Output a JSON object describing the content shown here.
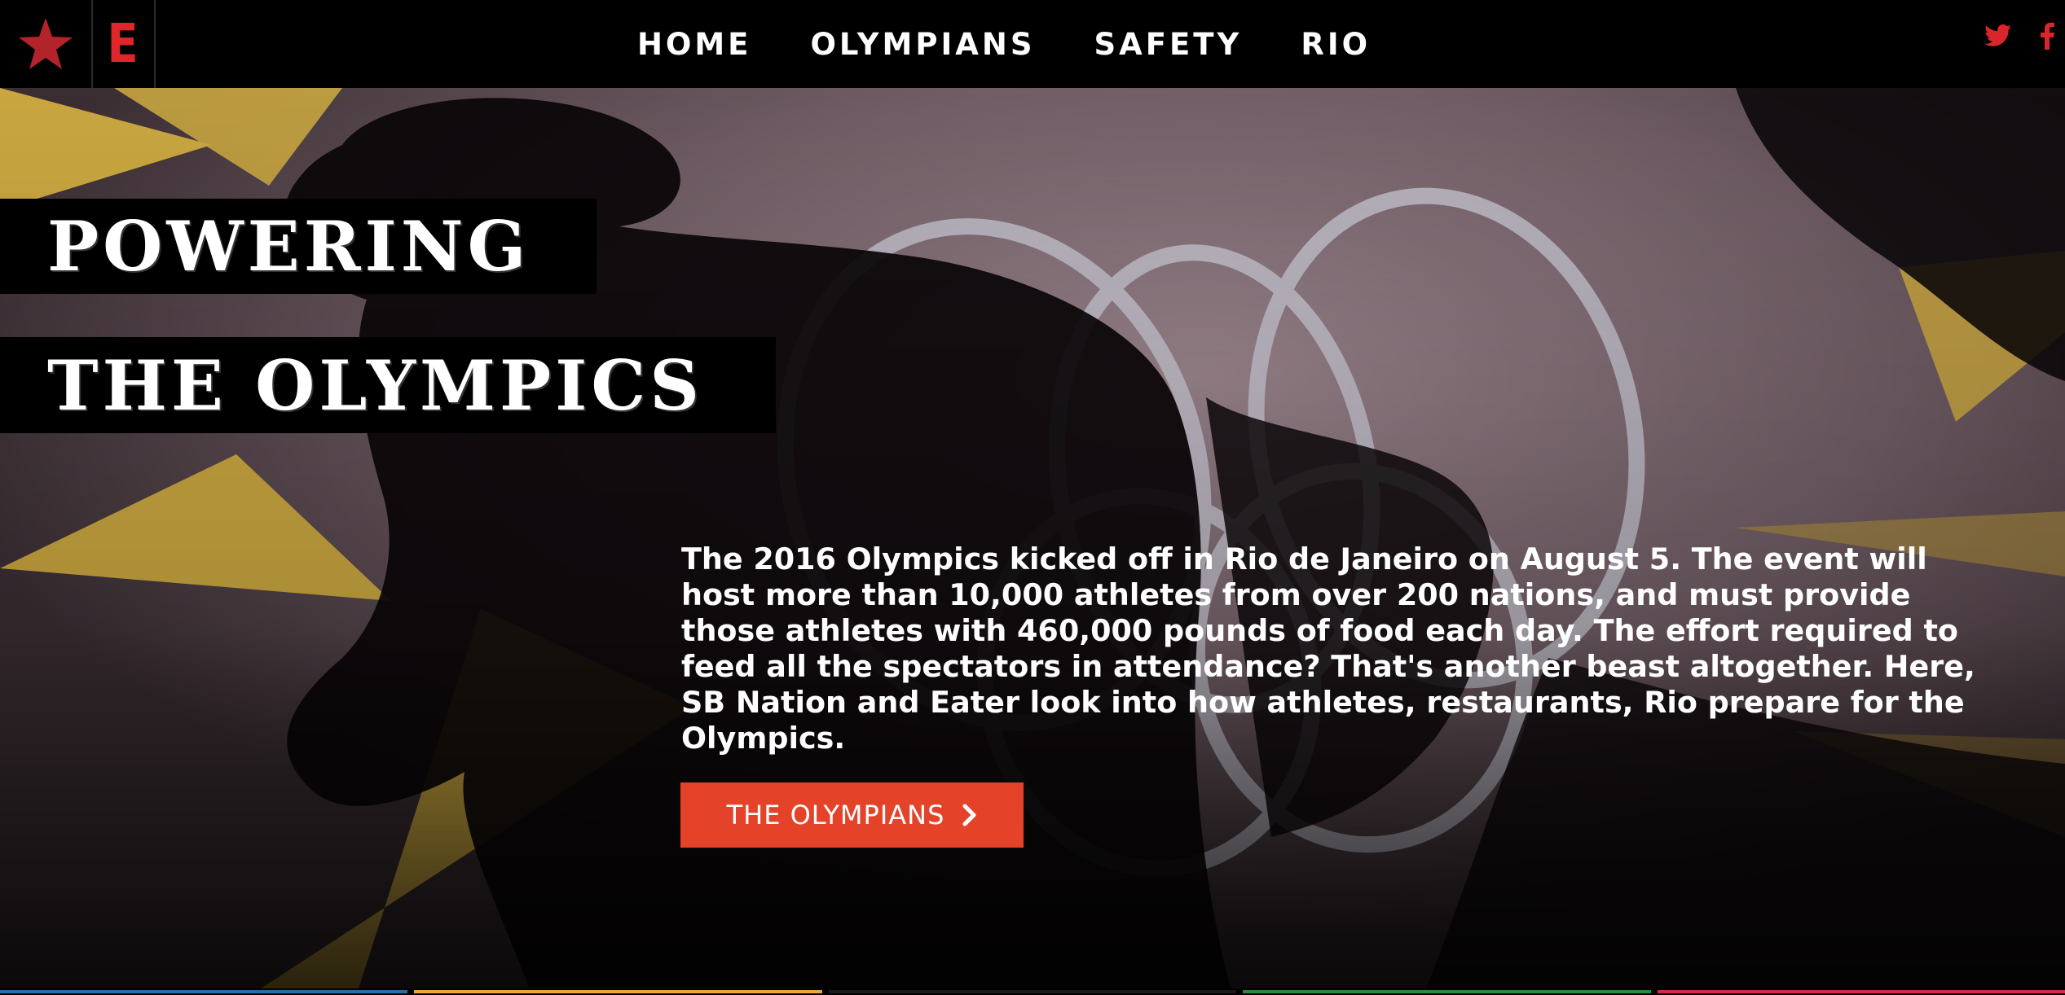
{
  "nav": {
    "items": [
      {
        "label": "HOME"
      },
      {
        "label": "OLYMPIANS"
      },
      {
        "label": "SAFETY"
      },
      {
        "label": "RIO"
      }
    ],
    "logo_letter": "E",
    "social": [
      "twitter-icon",
      "facebook-icon"
    ]
  },
  "hero": {
    "headline_line1": "POWERING",
    "headline_line2": "THE OLYMPICS",
    "intro": "The 2016 Olympics kicked off in Rio de Janeiro on August 5. The event will host more than 10,000 athletes from over 200 nations, and must provide those athletes with 460,000 pounds of food each day. The effort required to feed all the spectators in attendance? That's another beast altogether. Here, SB Nation and Eater look into how athletes, restaurants, Rio prepare for the Olympics.",
    "cta_label": "THE OLYMPIANS"
  },
  "colors": {
    "accent": "#e0262b",
    "cta": "#e4432a",
    "stripe": [
      "#2a6ea6",
      "#e8a93a",
      "#1a1a1a",
      "#2e8b3a",
      "#d8294a"
    ]
  }
}
